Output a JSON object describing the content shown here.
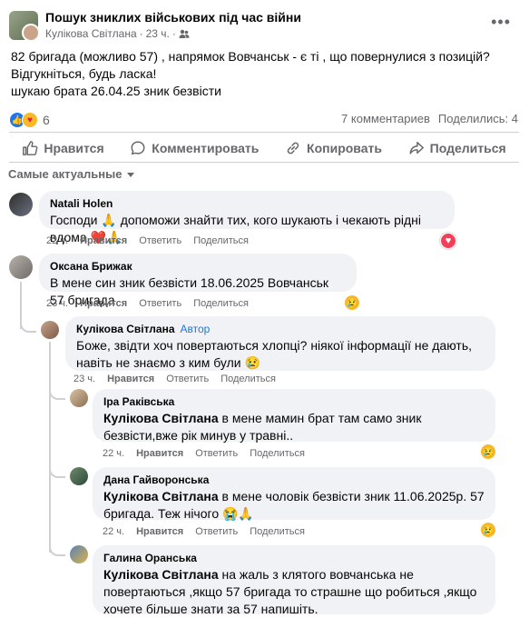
{
  "post": {
    "group_name": "Пошук зниклих військових під час війни",
    "author": "Кулікова Світлана",
    "time": "23 ч.",
    "text_line1": "82 бригада (можливо 57) , напрямок Вовчанськ - є ті , що повернулися з позицій?",
    "text_line2": "Відгукніться, будь ласка!",
    "text_line3": "шукаю брата 26.04.25 зник безвісти",
    "reactions_count": "6",
    "comments_count": "7 комментариев",
    "shares_count": "Поделились: 4"
  },
  "actions": {
    "like": "Нравится",
    "comment": "Комментировать",
    "copy": "Копировать",
    "share": "Поделиться"
  },
  "sort_label": "Самые актуальные",
  "comment_actions": {
    "like": "Нравится",
    "reply": "Ответить",
    "share": "Поделиться"
  },
  "comments": [
    {
      "name": "Natali Holen",
      "text": "Господи 🙏 допоможи знайти тих, кого шукають і чекають рідні вдома ❤️🙏",
      "time": "22 ч.",
      "reaction_icon": "love-icon"
    },
    {
      "name": "Оксана Брижак",
      "text": "В мене син зник безвісти 18.06.2025 Вовчанськ 57 бригада",
      "time": "23 ч.",
      "reaction_icon": "sad-icon"
    },
    {
      "name": "Кулікова Світлана",
      "author_badge": "Автор",
      "text": "Боже, звідти хоч повертаються хлопці? ніякої інформації не дають, навіть не знаємо з ким були 😢",
      "time": "23 ч."
    },
    {
      "name": "Іра Раківська",
      "mention": "Кулікова Світлана",
      "text": "в мене мамин брат там само зник безвісти,вже рік минув у травні..",
      "time": "22 ч.",
      "reaction_icon": "sad-icon"
    },
    {
      "name": "Дана Гайворонська",
      "mention": "Кулікова Світлана",
      "text": "в мене чоловік безвісти зник 11.06.2025р. 57 бригада. Теж нічого 😭🙏",
      "time": "22 ч.",
      "reaction_icon": "sad-icon"
    },
    {
      "name": "Галина Оранська",
      "mention": "Кулікова Світлана",
      "text": "на жаль з клятого вовчанська не повертаються ,якщо 57 бригада то страшне що робиться ,якщо хочете більше знати за 57 напишіть."
    }
  ]
}
